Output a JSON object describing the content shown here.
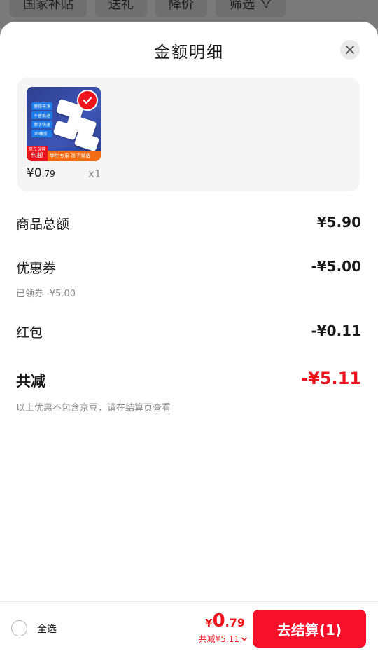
{
  "top_filters": [
    {
      "label": "国家补贴"
    },
    {
      "label": "送礼"
    },
    {
      "label": "降价"
    },
    {
      "label": "筛选",
      "icon": "filter-icon"
    }
  ],
  "sheet": {
    "title": "金额明细",
    "close_icon": "close-icon"
  },
  "product": {
    "image_tags": [
      "擦得干净",
      "不留痕迹",
      "擦字快速",
      "2B橡皮"
    ],
    "image_banner": "学生专用 孩子常备",
    "image_badge_top": "京东自营",
    "image_badge_bottom": "包邮",
    "price_yen": "¥",
    "price_int": "0",
    "price_dec": ".79",
    "quantity": "x1"
  },
  "breakdown": {
    "goods_total_label": "商品总额",
    "goods_total_value": "¥5.90",
    "coupon_label": "优惠券",
    "coupon_value": "-¥5.00",
    "coupon_note": "已领券 -¥5.00",
    "redpacket_label": "红包",
    "redpacket_value": "-¥0.11",
    "total_discount_label": "共减",
    "total_discount_value": "-¥5.11",
    "disclaimer": "以上优惠不包含京豆，请在结算页查看"
  },
  "footer": {
    "select_all_label": "全选",
    "price_yen": "¥",
    "price_int": "0",
    "price_dec": ".79",
    "discount_text": "共减¥5.11",
    "checkout_label": "去结算(1)"
  },
  "colors": {
    "accent_red": "#f0141e",
    "checkout_red": "#f8102a"
  }
}
